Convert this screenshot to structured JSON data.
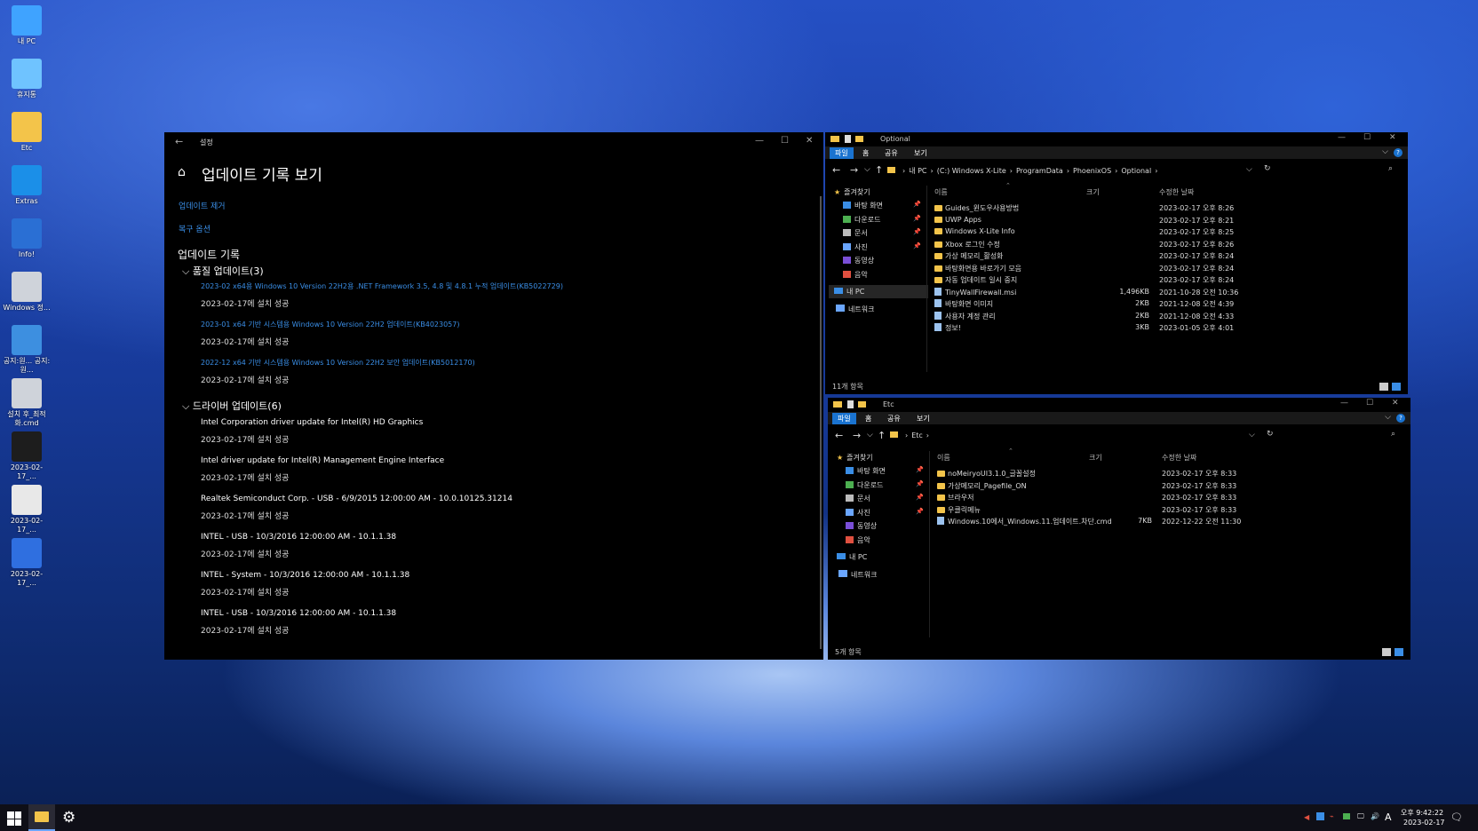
{
  "desktop": {
    "icons": [
      {
        "label": "내 PC",
        "color": "#3fa3ff"
      },
      {
        "label": "휴지통",
        "color": "#6fc3ff"
      },
      {
        "label": "Etc",
        "color": "#f3c44a"
      },
      {
        "label": "Extras",
        "color": "#1b8fe8"
      },
      {
        "label": "Info!",
        "color": "#2a6fd4"
      },
      {
        "label": "Windows 정...",
        "color": "#cfd3da"
      },
      {
        "label": "공지:원... 공지:원...",
        "color": "#3d8fe0"
      },
      {
        "label": "설치 후_최적화.cmd",
        "color": "#cfd3da"
      },
      {
        "label": "2023-02-17_...",
        "color": "#1d1d1d"
      },
      {
        "label": "2023-02-17_...",
        "color": "#e8e8e8"
      },
      {
        "label": "2023-02-17_...",
        "color": "#2f6fe0"
      }
    ]
  },
  "settings": {
    "title": "설정",
    "page_title": "업데이트 기록 보기",
    "links": [
      "업데이트 제거",
      "복구 옵션"
    ],
    "section_title": "업데이트 기록",
    "quality_group": "품질 업데이트(3)",
    "quality_updates": [
      {
        "name": "2023-02 x64용 Windows 10 Version 22H2용 .NET Framework 3.5, 4.8 및 4.8.1 누적 업데이트(KB5022729)",
        "status": "2023-02-17에 설치 성공"
      },
      {
        "name": "2023-01 x64 기반 시스템용 Windows 10 Version 22H2 업데이트(KB4023057)",
        "status": "2023-02-17에 설치 성공"
      },
      {
        "name": "2022-12 x64 기반 시스템용 Windows 10 Version 22H2 보안 업데이트(KB5012170)",
        "status": "2023-02-17에 설치 성공"
      }
    ],
    "driver_group": "드라이버 업데이트(6)",
    "driver_updates": [
      {
        "name": "Intel Corporation driver update for Intel(R) HD Graphics",
        "status": "2023-02-17에 설치 성공"
      },
      {
        "name": "Intel driver update for Intel(R) Management Engine Interface",
        "status": "2023-02-17에 설치 성공"
      },
      {
        "name": "Realtek Semiconduct Corp. - USB - 6/9/2015 12:00:00 AM - 10.0.10125.31214",
        "status": "2023-02-17에 설치 성공"
      },
      {
        "name": "INTEL - USB - 10/3/2016 12:00:00 AM - 10.1.1.38",
        "status": "2023-02-17에 설치 성공"
      },
      {
        "name": "INTEL - System - 10/3/2016 12:00:00 AM - 10.1.1.38",
        "status": "2023-02-17에 설치 성공"
      },
      {
        "name": "INTEL - USB - 10/3/2016 12:00:00 AM - 10.1.1.38",
        "status": "2023-02-17에 설치 성공"
      }
    ]
  },
  "explorer_ribbon_tabs": [
    "파일",
    "홈",
    "공유",
    "보기"
  ],
  "explorer_columns": [
    "이름",
    "크기",
    "수정한 날짜"
  ],
  "explorer_nav": {
    "quick_access": "즐겨찾기",
    "items": [
      "바탕 화면",
      "다운로드",
      "문서",
      "사진",
      "동영상",
      "음악"
    ],
    "this_pc": "내 PC",
    "network": "네트워크"
  },
  "explorer1": {
    "title": "Optional",
    "path": [
      "내 PC",
      "(C:) Windows X-Lite",
      "ProgramData",
      "PhoenixOS",
      "Optional"
    ],
    "files": [
      {
        "name": "Guides_윈도우사용방법",
        "size": "",
        "date": "2023-02-17 오후 8:26",
        "type": "folder"
      },
      {
        "name": "UWP Apps",
        "size": "",
        "date": "2023-02-17 오후 8:21",
        "type": "folder"
      },
      {
        "name": "Windows X-Lite Info",
        "size": "",
        "date": "2023-02-17 오후 8:25",
        "type": "folder"
      },
      {
        "name": "Xbox 로그인 수정",
        "size": "",
        "date": "2023-02-17 오후 8:26",
        "type": "folder"
      },
      {
        "name": "가상 메모리_활성화",
        "size": "",
        "date": "2023-02-17 오후 8:24",
        "type": "folder"
      },
      {
        "name": "바탕화면용 바로가기 모음",
        "size": "",
        "date": "2023-02-17 오후 8:24",
        "type": "folder"
      },
      {
        "name": "자동 업데이트 일시 중지",
        "size": "",
        "date": "2023-02-17 오후 8:24",
        "type": "folder"
      },
      {
        "name": "TinyWallFirewall.msi",
        "size": "1,496KB",
        "date": "2021-10-28 오전 10:36",
        "type": "file"
      },
      {
        "name": "바탕화면 이미지",
        "size": "2KB",
        "date": "2021-12-08 오전 4:39",
        "type": "file"
      },
      {
        "name": "사용자 계정 관리",
        "size": "2KB",
        "date": "2021-12-08 오전 4:33",
        "type": "file"
      },
      {
        "name": "정보!",
        "size": "3KB",
        "date": "2023-01-05 오후 4:01",
        "type": "file"
      }
    ],
    "status": "11개 항목"
  },
  "explorer2": {
    "title": "Etc",
    "path": [
      "Etc"
    ],
    "files": [
      {
        "name": "noMeiryoUI3.1.0_글꼴설정",
        "size": "",
        "date": "2023-02-17 오후 8:33",
        "type": "folder"
      },
      {
        "name": "가상메모리_Pagefile_ON",
        "size": "",
        "date": "2023-02-17 오후 8:33",
        "type": "folder"
      },
      {
        "name": "브라우저",
        "size": "",
        "date": "2023-02-17 오후 8:33",
        "type": "folder"
      },
      {
        "name": "우클릭메뉴",
        "size": "",
        "date": "2023-02-17 오후 8:33",
        "type": "folder"
      },
      {
        "name": "Windows.10에서_Windows.11.업데이트.차단.cmd",
        "size": "7KB",
        "date": "2022-12-22 오전 11:30",
        "type": "file"
      }
    ],
    "status": "5개 항목"
  },
  "taskbar": {
    "time": "오후 9:42:22",
    "date": "2023-02-17",
    "ime": "A"
  },
  "colors": {
    "accent": "#1a73d0",
    "link": "#3a8ee6",
    "folder": "#f3c44a"
  }
}
